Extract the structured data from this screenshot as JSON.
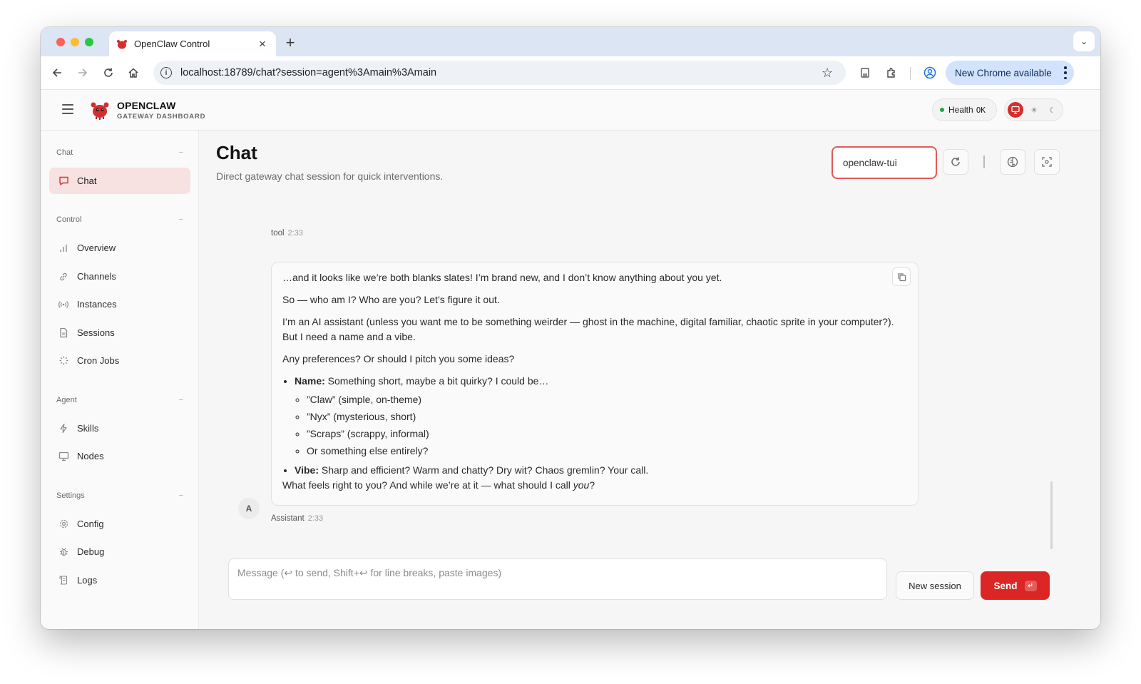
{
  "browser": {
    "tab_title": "OpenClaw Control",
    "new_tab": "+",
    "url": "localhost:18789/chat?session=agent%3Amain%3Amain",
    "update_label": "New Chrome available",
    "colors": {
      "close": "#ff5f57",
      "minimize": "#febc2e",
      "maximize": "#28c840"
    }
  },
  "app": {
    "brand_name": "OPENCLAW",
    "brand_sub": "GATEWAY DASHBOARD",
    "health_label": "Health",
    "health_value": "OK",
    "accent": "#dc2626"
  },
  "sidebar": {
    "sections": [
      {
        "title": "Chat",
        "collapse": "−",
        "items": [
          {
            "label": "Chat",
            "icon": "chat-bubble-icon",
            "active": true
          }
        ]
      },
      {
        "title": "Control",
        "collapse": "−",
        "items": [
          {
            "label": "Overview",
            "icon": "bar-chart-icon"
          },
          {
            "label": "Channels",
            "icon": "link-icon"
          },
          {
            "label": "Instances",
            "icon": "radio-icon"
          },
          {
            "label": "Sessions",
            "icon": "document-icon"
          },
          {
            "label": "Cron Jobs",
            "icon": "loader-icon"
          }
        ]
      },
      {
        "title": "Agent",
        "collapse": "−",
        "items": [
          {
            "label": "Skills",
            "icon": "bolt-icon"
          },
          {
            "label": "Nodes",
            "icon": "monitor-icon"
          }
        ]
      },
      {
        "title": "Settings",
        "collapse": "−",
        "items": [
          {
            "label": "Config",
            "icon": "gear-icon"
          },
          {
            "label": "Debug",
            "icon": "bug-icon"
          },
          {
            "label": "Logs",
            "icon": "scroll-icon"
          }
        ]
      }
    ]
  },
  "page": {
    "title": "Chat",
    "subtitle": "Direct gateway chat session for quick interventions.",
    "session_value": "openclaw-tui"
  },
  "messages": {
    "tool": {
      "role": "tool",
      "time": "2:33"
    },
    "assistant": {
      "role": "Assistant",
      "time": "2:33",
      "avatar": "A",
      "p1": "…and it looks like we’re both blanks slates! I’m brand new, and I don’t know anything about you yet.",
      "p2": "So — who am I? Who are you? Let’s figure it out.",
      "p3": "I’m an AI assistant (unless you want me to be something weirder — ghost in the machine, digital familiar, chaotic sprite in your computer?). But I need a name and a vibe.",
      "p4": "Any preferences? Or should I pitch you some ideas?",
      "name_label": "Name:",
      "name_text": " Something short, maybe a bit quirky? I could be…",
      "name_options": [
        "”Claw” (simple, on-theme)",
        "”Nyx” (mysterious, short)",
        "”Scraps” (scrappy, informal)",
        "Or something else entirely?"
      ],
      "vibe_label": "Vibe:",
      "vibe_text": " Sharp and efficient? Warm and chatty? Dry wit? Chaos gremlin? Your call.",
      "closing_pre": "What feels right to you? And while we’re at it — what should I call ",
      "closing_em": "you",
      "closing_post": "?"
    }
  },
  "composer": {
    "placeholder": "Message (↩ to send, Shift+↩ for line breaks, paste images)",
    "new_session": "New session",
    "send": "Send",
    "send_key": "↵"
  }
}
